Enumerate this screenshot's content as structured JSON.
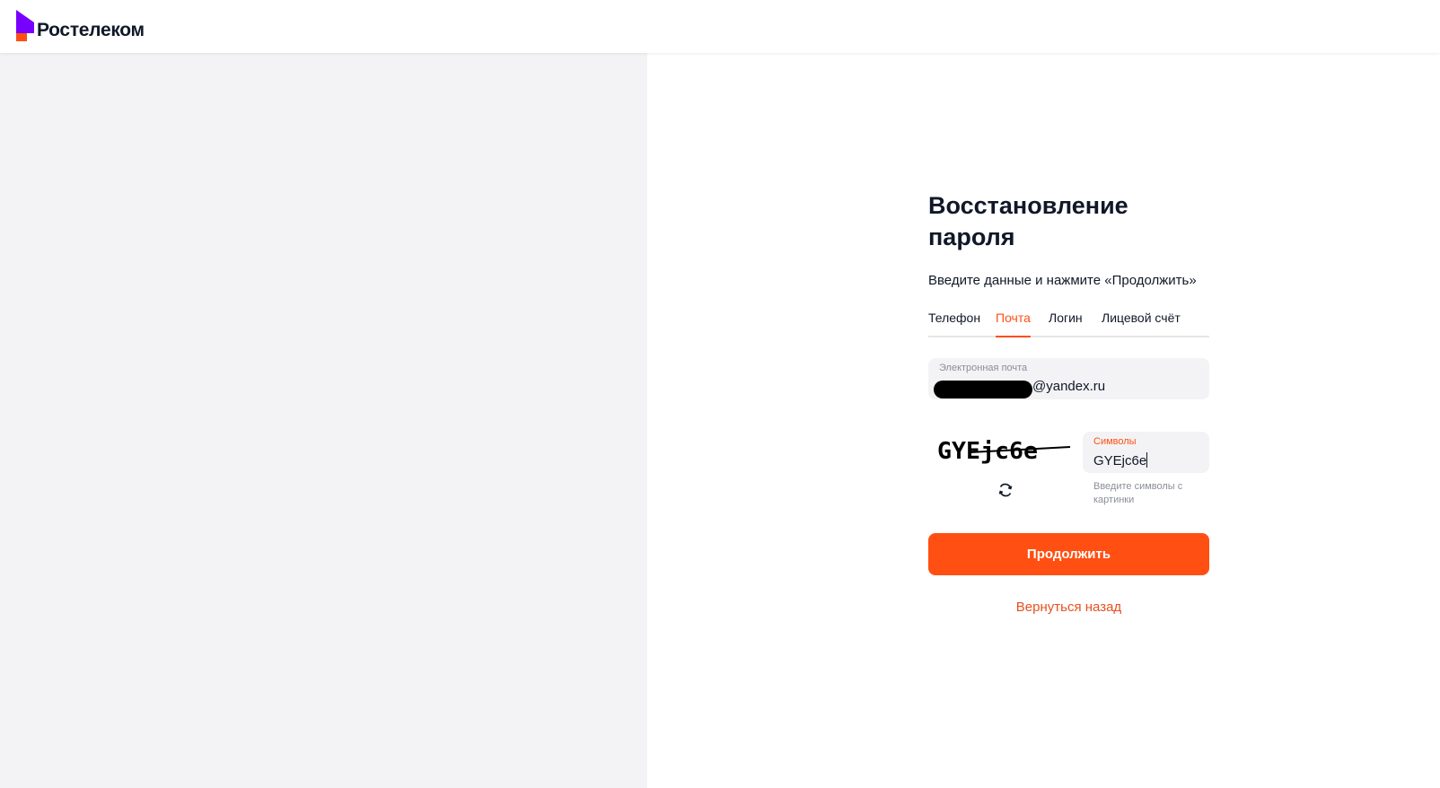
{
  "header": {
    "logo_text": "Ростелеком",
    "logo_icon": "rostelecom-logo-icon"
  },
  "form": {
    "title": "Восстановление пароля",
    "subtitle": "Введите данные и нажмите «Продолжить»",
    "tabs": [
      {
        "label": "Телефон",
        "active": false
      },
      {
        "label": "Почта",
        "active": true
      },
      {
        "label": "Логин",
        "active": false
      },
      {
        "label": "Лицевой счёт",
        "active": false
      }
    ],
    "email": {
      "label": "Электронная почта",
      "value_visible": "@yandex.ru"
    },
    "captcha": {
      "image_text": "GYEjc6e",
      "refresh_icon": "refresh-icon",
      "input_label": "Символы",
      "input_value": "GYEjc6e",
      "hint": "Введите символы с картинки"
    },
    "continue_label": "Продолжить",
    "back_label": "Вернуться назад"
  },
  "colors": {
    "accent": "#ff4f12",
    "brand_purple": "#7700ff",
    "left_panel_bg": "#f3f3f5",
    "field_bg": "#f3f3f5",
    "text": "#101828",
    "muted_text": "#8a8e99"
  }
}
